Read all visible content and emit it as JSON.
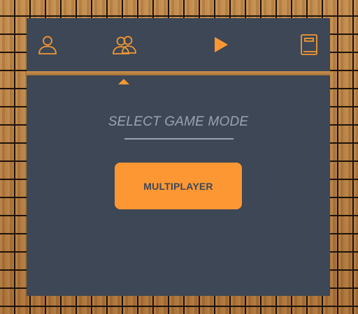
{
  "nav": {
    "items": [
      {
        "icon": "single-player-icon"
      },
      {
        "icon": "multiplayer-icon"
      },
      {
        "icon": "play-icon"
      },
      {
        "icon": "rules-book-icon"
      }
    ],
    "active_index": 1
  },
  "content": {
    "heading": "SELECT GAME MODE",
    "mode_button_label": "MULTIPLAYER"
  },
  "colors": {
    "accent": "#fd9733",
    "panel": "#3d4756",
    "muted_text": "#9aa3b0",
    "wood": "#b07a3e"
  }
}
